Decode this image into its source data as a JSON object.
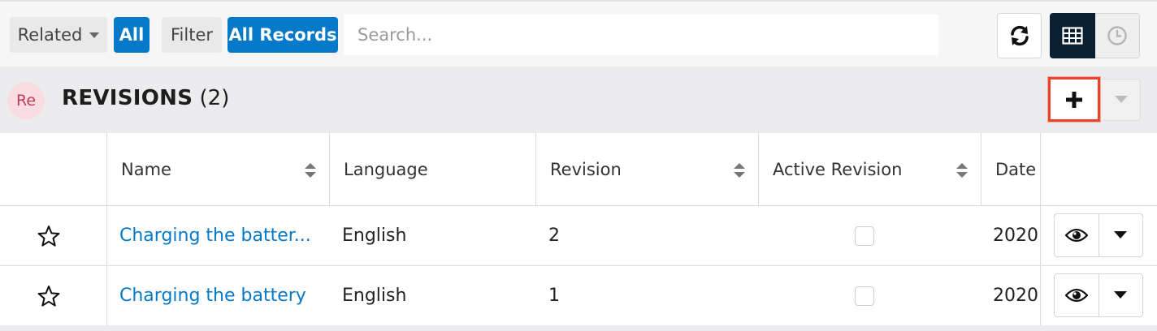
{
  "toolbar": {
    "related_label": "Related",
    "related_value": "All",
    "filter_label": "Filter",
    "filter_value": "All Records",
    "search_placeholder": "Search..."
  },
  "subpanel": {
    "avatar": "Re",
    "title": "REVISIONS",
    "count": "(2)"
  },
  "table": {
    "columns": [
      {
        "label": "Name",
        "sortable": true
      },
      {
        "label": "Language",
        "sortable": false
      },
      {
        "label": "Revision",
        "sortable": true
      },
      {
        "label": "Active Revision",
        "sortable": true
      },
      {
        "label": "Date",
        "sortable": false
      }
    ],
    "rows": [
      {
        "name": "Charging the batter...",
        "language": "English",
        "revision": "2",
        "active": false,
        "date": "2020"
      },
      {
        "name": "Charging the battery",
        "language": "English",
        "revision": "1",
        "active": false,
        "date": "2020"
      }
    ]
  },
  "colors": {
    "accent": "#0679c8",
    "highlight": "#e8452b",
    "avatar_bg": "#fadde2",
    "avatar_text": "#c23a55"
  },
  "icons": [
    "refresh-icon",
    "list-view-icon",
    "clock-icon",
    "plus-icon",
    "caret-down-icon",
    "star-icon",
    "eye-icon",
    "sort-icon"
  ]
}
